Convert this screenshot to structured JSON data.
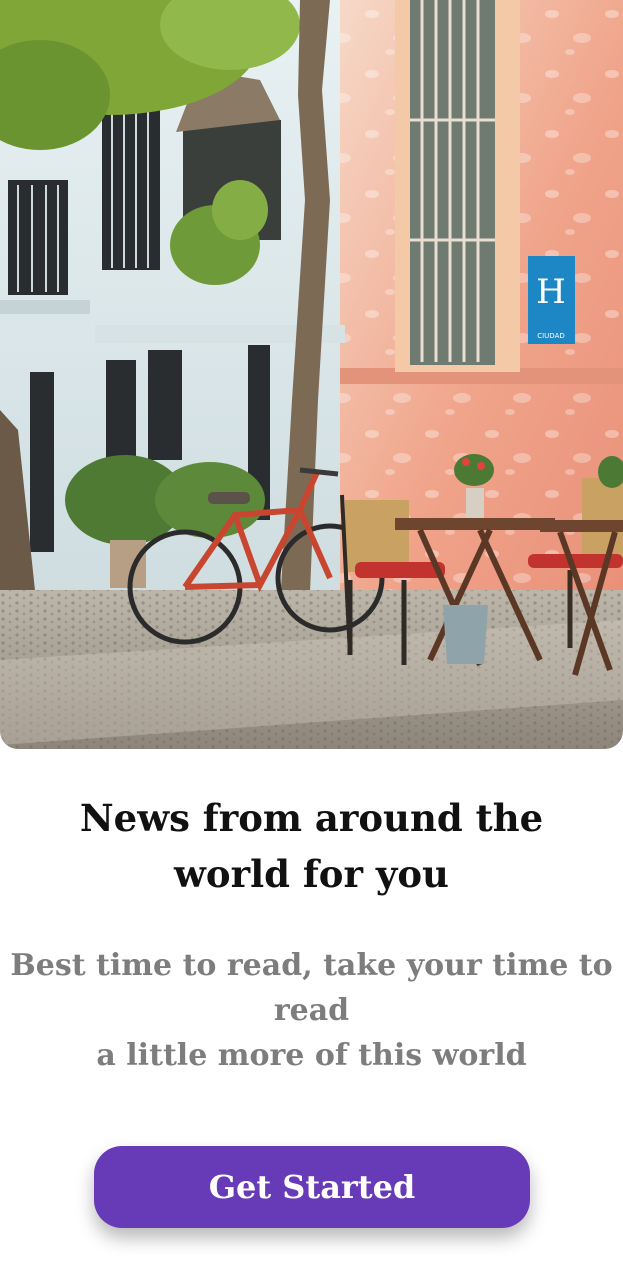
{
  "hero": {
    "sign_letter": "H",
    "sign_caption": "CIUDAD",
    "colors": {
      "wall_left": "#dde9ec",
      "wall_right": "#f0a98f",
      "pavement": "#9c9488",
      "bike": "#c8462f",
      "tree": "#7fa636"
    }
  },
  "onboarding": {
    "title": "News from around the world for you",
    "subtitle_line1": "Best time to read, take your time to read",
    "subtitle_line2": "a little more of this world"
  },
  "cta": {
    "label": "Get Started",
    "color": "#673ab7"
  }
}
